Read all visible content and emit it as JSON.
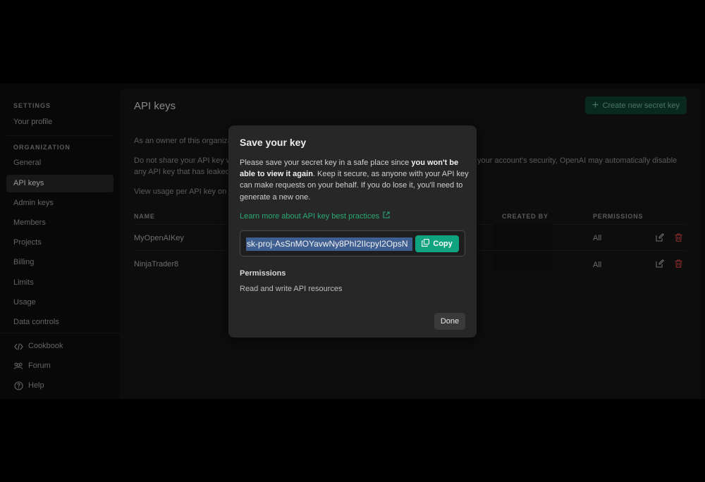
{
  "sidebar": {
    "settings_heading": "SETTINGS",
    "your_profile": "Your profile",
    "organization_heading": "ORGANIZATION",
    "items": [
      {
        "label": "General"
      },
      {
        "label": "API keys"
      },
      {
        "label": "Admin keys"
      },
      {
        "label": "Members"
      },
      {
        "label": "Projects"
      },
      {
        "label": "Billing"
      },
      {
        "label": "Limits"
      },
      {
        "label": "Usage"
      },
      {
        "label": "Data controls"
      }
    ],
    "footer": [
      {
        "label": "Cookbook",
        "icon": "code-icon"
      },
      {
        "label": "Forum",
        "icon": "people-icon"
      },
      {
        "label": "Help",
        "icon": "help-icon"
      }
    ]
  },
  "main": {
    "title": "API keys",
    "create_button": "Create new secret key",
    "owner_text": "As an owner of this organiza",
    "share_text_line1": "Do not share your API key w",
    "share_text_line1_right": "your account's security, OpenAI may automatically disable",
    "share_text_line2": "any API key that has leaked",
    "usage_text": "View usage per API key on t",
    "columns": {
      "name": "NAME",
      "created_by": "CREATED BY",
      "permissions": "PERMISSIONS"
    },
    "rows": [
      {
        "name": "MyOpenAIKey",
        "permissions": "All"
      },
      {
        "name": "NinjaTrader8",
        "permissions": "All"
      }
    ]
  },
  "modal": {
    "title": "Save your key",
    "desc_part1": "Please save your secret key in a safe place since ",
    "desc_bold": "you won't be able to view it again",
    "desc_part2": ". Keep it secure, as anyone with your API key can make requests on your behalf. If you do lose it, you'll need to generate a new one.",
    "link": "Learn more about API key best practices",
    "key_value": "sk-proj-AsSnMOYavwNy8PhI2IIcpyI2OpsN",
    "copy_button": "Copy",
    "permissions_title": "Permissions",
    "permissions_value": "Read and write API resources",
    "done_button": "Done"
  },
  "colors": {
    "accent": "#10a37f",
    "danger": "#d64545"
  }
}
